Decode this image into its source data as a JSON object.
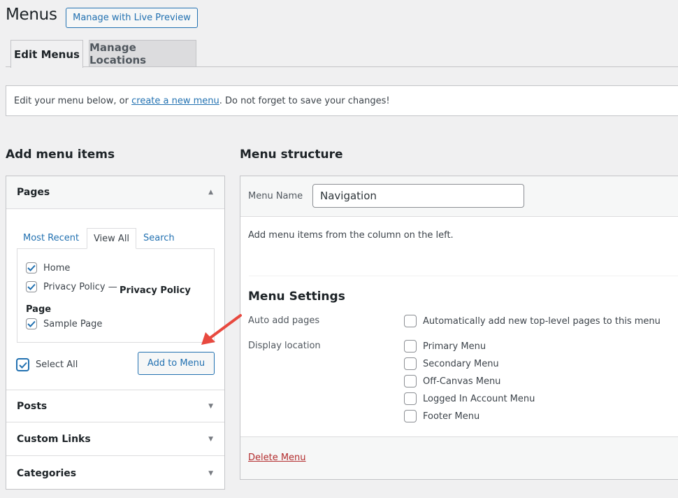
{
  "header": {
    "title": "Menus",
    "live_preview_button": "Manage with Live Preview"
  },
  "tabs": [
    {
      "label": "Edit Menus",
      "active": true
    },
    {
      "label": "Manage Locations",
      "active": false
    }
  ],
  "notice": {
    "before": "Edit your menu below, or ",
    "link": "create a new menu",
    "after": ". Do not forget to save your changes!"
  },
  "add_items": {
    "heading": "Add menu items",
    "pages": {
      "title": "Pages",
      "tabs": [
        "Most Recent",
        "View All",
        "Search"
      ],
      "active_tab": "View All",
      "items": [
        {
          "label": "Home",
          "checked": true
        },
        {
          "label": "Privacy Policy — ",
          "bold": "Privacy Policy Page",
          "checked": true
        },
        {
          "label": "Sample Page",
          "checked": true
        }
      ],
      "select_all": {
        "label": "Select All",
        "checked": true
      },
      "add_button": "Add to Menu"
    },
    "sections": [
      {
        "title": "Posts"
      },
      {
        "title": "Custom Links"
      },
      {
        "title": "Categories"
      }
    ]
  },
  "structure": {
    "heading": "Menu structure",
    "menu_name_label": "Menu Name",
    "menu_name_value": "Navigation",
    "empty_text": "Add menu items from the column on the left.",
    "settings_heading": "Menu Settings",
    "auto_add_label": "Auto add pages",
    "auto_add_option": {
      "label": "Automatically add new top-level pages to this menu",
      "checked": false
    },
    "display_location_label": "Display location",
    "locations": [
      {
        "label": "Primary Menu",
        "checked": false
      },
      {
        "label": "Secondary Menu",
        "checked": false
      },
      {
        "label": "Off-Canvas Menu",
        "checked": false
      },
      {
        "label": "Logged In Account Menu",
        "checked": false
      },
      {
        "label": "Footer Menu",
        "checked": false
      }
    ],
    "delete_link": "Delete Menu"
  },
  "colors": {
    "accent": "#2271b1",
    "danger": "#b32d2e",
    "annotation_arrow": "#e8493f"
  }
}
